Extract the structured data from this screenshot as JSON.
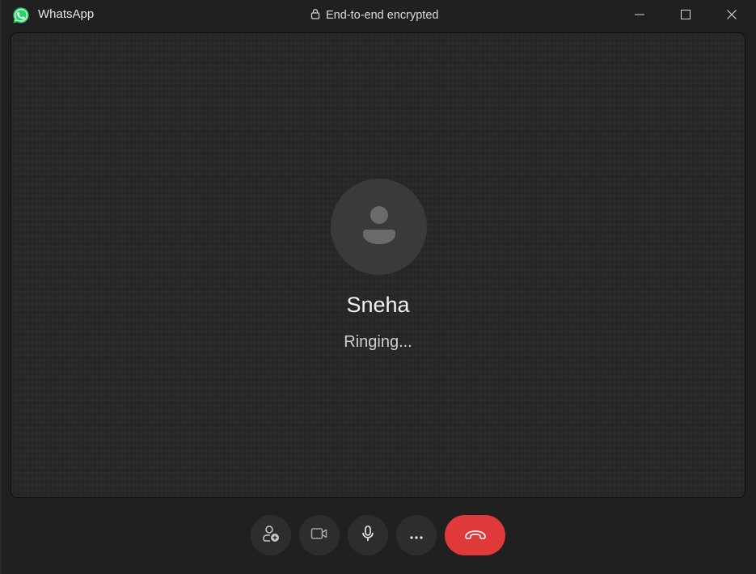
{
  "window": {
    "app_title": "WhatsApp",
    "encryption_label": "End-to-end encrypted",
    "controls": {
      "minimize": "minimize-icon",
      "maximize": "maximize-icon",
      "close": "close-icon"
    }
  },
  "call": {
    "contact_name": "Sneha",
    "status": "Ringing...",
    "avatar_icon": "person-icon"
  },
  "controls": [
    {
      "name": "add-participant",
      "icon": "person-add-icon"
    },
    {
      "name": "video",
      "icon": "video-camera-icon"
    },
    {
      "name": "microphone",
      "icon": "microphone-icon"
    },
    {
      "name": "more-options",
      "icon": "more-horizontal-icon"
    },
    {
      "name": "end-call",
      "icon": "phone-hangup-icon"
    }
  ],
  "colors": {
    "brand": "#25d366",
    "end_call": "#e0393a",
    "background": "#202020"
  }
}
